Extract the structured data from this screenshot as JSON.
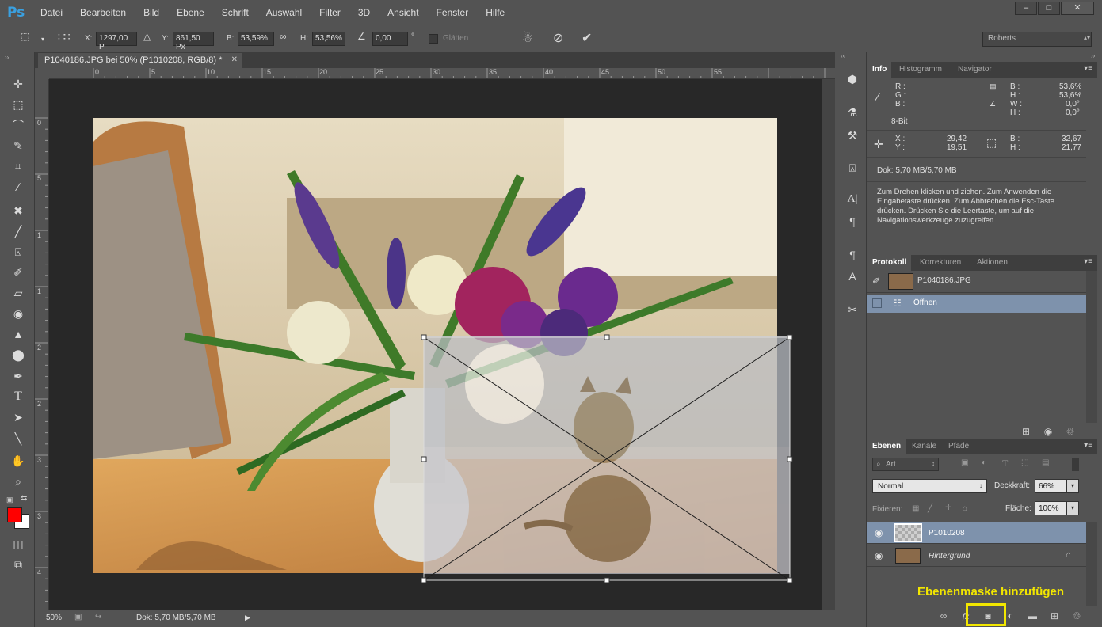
{
  "app": {
    "logo": "Ps",
    "menu": [
      "Datei",
      "Bearbeiten",
      "Bild",
      "Ebene",
      "Schrift",
      "Auswahl",
      "Filter",
      "3D",
      "Ansicht",
      "Fenster",
      "Hilfe"
    ],
    "window_controls": [
      "–",
      "□",
      "✕"
    ]
  },
  "options": {
    "x_label": "X:",
    "x_value": "1297,00 P",
    "y_label": "Y:",
    "y_value": "861,50 Px",
    "w_label": "B:",
    "w_value": "53,59%",
    "h_label": "H:",
    "h_value": "53,56%",
    "angle_value": "0,00",
    "angle_unit": "°",
    "smooth_label": "Glätten",
    "workspace": "Roberts"
  },
  "document": {
    "tab_title": "P1040186.JPG bei 50% (P1010208, RGB/8) *",
    "ruler_h": [
      "0",
      "5",
      "10",
      "15",
      "20",
      "25",
      "30",
      "35",
      "40",
      "45",
      "50",
      "55"
    ],
    "ruler_v": [
      "0",
      "5",
      "1",
      "1",
      "2",
      "2",
      "3",
      "3",
      "4"
    ],
    "zoom": "50%",
    "doc_size": "Dok: 5,70 MB/5,70 MB"
  },
  "info_panel": {
    "tabs": [
      "Info",
      "Histogramm",
      "Navigator"
    ],
    "rgb_labels": [
      "R :",
      "G :",
      "B :"
    ],
    "bit_depth": "8-Bit",
    "cmyk_labels": [
      "B :",
      "H :",
      "W :",
      "H :"
    ],
    "cmyk_values": [
      "53,6%",
      "53,6%",
      "0,0°",
      "0,0°"
    ],
    "x_label": "X :",
    "y_label": "Y :",
    "x_value": "29,42",
    "y_value": "19,51",
    "w_label": "B :",
    "h_label": "H :",
    "w_value": "32,67",
    "h_value": "21,77",
    "doc": "Dok: 5,70 MB/5,70 MB",
    "hint": "Zum Drehen klicken und ziehen. Zum Anwenden die Eingabetaste drücken. Zum Abbrechen die Esc-Taste drücken. Drücken Sie die Leertaste, um auf die Navigationswerkzeuge zuzugreifen."
  },
  "history_panel": {
    "tabs": [
      "Protokoll",
      "Korrekturen",
      "Aktionen"
    ],
    "snapshot": "P1040186.JPG",
    "items": [
      "Öffnen"
    ]
  },
  "layers_panel": {
    "tabs": [
      "Ebenen",
      "Kanäle",
      "Pfade"
    ],
    "filter": "Art",
    "blend_mode": "Normal",
    "opacity_label": "Deckkraft:",
    "opacity_value": "66%",
    "lock_label": "Fixieren:",
    "fill_label": "Fläche:",
    "fill_value": "100%",
    "layers": [
      {
        "name": "P1010208",
        "selected": true
      },
      {
        "name": "Hintergrund",
        "selected": false
      }
    ]
  },
  "annotation": {
    "text": "Ebenenmaske hinzufügen",
    "color": "#f2e600"
  },
  "colors": {
    "foreground": "#ff0000",
    "background": "#ffffff",
    "selection": "#7e92ac",
    "panel": "#535353"
  }
}
